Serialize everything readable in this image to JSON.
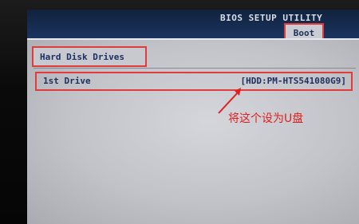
{
  "header": {
    "title": "BIOS SETUP UTILITY",
    "active_tab": "Boot"
  },
  "section": {
    "title": "Hard Disk Drives"
  },
  "drives": [
    {
      "label": "1st Drive",
      "value": "[HDD:PM-HTS541080G9]"
    }
  ],
  "annotation": {
    "text": "将这个设为U盘",
    "color": "#e0201e"
  },
  "colors": {
    "highlight_box": "#e23b3b",
    "header_blue": "#1b3560",
    "text_blue": "#1c2f5e"
  }
}
